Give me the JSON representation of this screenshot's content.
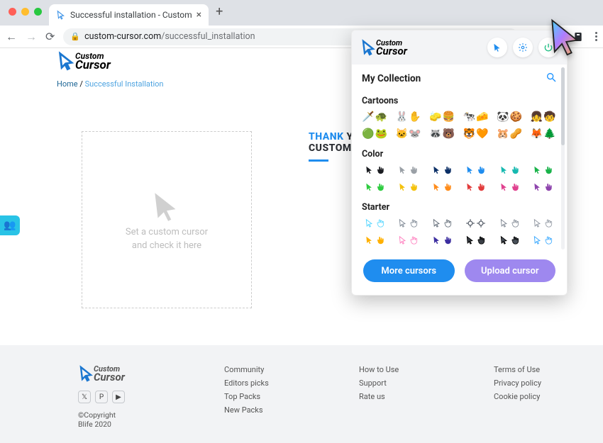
{
  "browser": {
    "tab_title": "Successful installation - Custom",
    "url_host": "custom-cursor.com",
    "url_path": "/successful_installation"
  },
  "header": {
    "logo_top": "Custom",
    "logo_bottom": "Cursor"
  },
  "breadcrumb": {
    "home": "Home",
    "sep": " / ",
    "current": "Successful Installation"
  },
  "preview": {
    "line1": "Set a custom cursor",
    "line2": "and check it here"
  },
  "thanks": {
    "word1": "THANK",
    "word2": " YOU ",
    "line2": "CUSTOM CUR"
  },
  "popup": {
    "logo_top": "Custom",
    "logo_bottom": "Cursor",
    "collection_title": "My Collection",
    "sections": {
      "cartoons": "Cartoons",
      "color": "Color",
      "starter": "Starter"
    },
    "more_btn": "More cursors",
    "upload_btn": "Upload cursor"
  },
  "cursor_sets": {
    "cartoons": [
      {
        "a": "🗡️",
        "b": "🐢"
      },
      {
        "a": "🐰",
        "b": "✋"
      },
      {
        "a": "🧽",
        "b": "🍔"
      },
      {
        "a": "🐄",
        "b": "🧀"
      },
      {
        "a": "🐼",
        "b": "🍪"
      },
      {
        "a": "👧",
        "b": "🧒"
      },
      {
        "a": "🟢",
        "b": "🐸"
      },
      {
        "a": "🐱",
        "b": "🐭"
      },
      {
        "a": "🦝",
        "b": "🐻"
      },
      {
        "a": "🐯",
        "b": "🧡"
      },
      {
        "a": "🐹",
        "b": "🥜"
      },
      {
        "a": "🦊",
        "b": "🌲"
      }
    ],
    "color": [
      {
        "c": "#1b1d21"
      },
      {
        "c": "#9aa0a6"
      },
      {
        "c": "#0b2f66"
      },
      {
        "c": "#1f8def"
      },
      {
        "c": "#17b9b0"
      },
      {
        "c": "#19b34a"
      },
      {
        "c": "#2ecc40"
      },
      {
        "c": "#f4c20d"
      },
      {
        "c": "#ff8c1a"
      },
      {
        "c": "#e23b3b"
      },
      {
        "c": "#e0418f"
      },
      {
        "c": "#8e44ad"
      }
    ],
    "starter": [
      {
        "t": "outline",
        "c": "#55d6ff"
      },
      {
        "t": "outline",
        "c": "#7e8894"
      },
      {
        "t": "outline",
        "c": "#606a76"
      },
      {
        "t": "cross",
        "c": "#505863"
      },
      {
        "t": "outline",
        "c": "#808893"
      },
      {
        "t": "outline",
        "c": "#9198a2"
      },
      {
        "t": "solid",
        "c": "#ffb000"
      },
      {
        "t": "outline",
        "c": "#ff7fbf"
      },
      {
        "t": "solid",
        "c": "#3c2ea0"
      },
      {
        "t": "pixel",
        "c": "#3a3f46"
      },
      {
        "t": "pixel",
        "c": "#49515a"
      },
      {
        "t": "outline",
        "c": "#3aa9ff"
      }
    ]
  },
  "footer": {
    "logo_top": "Custom",
    "logo_bottom": "Cursor",
    "copyright": "©Copyright Blife 2020",
    "col1": [
      "Community",
      "Editors picks",
      "Top Packs",
      "New Packs"
    ],
    "col2": [
      "How to Use",
      "Support",
      "Rate us"
    ],
    "col3": [
      "Terms of Use",
      "Privacy policy",
      "Cookie policy"
    ]
  }
}
